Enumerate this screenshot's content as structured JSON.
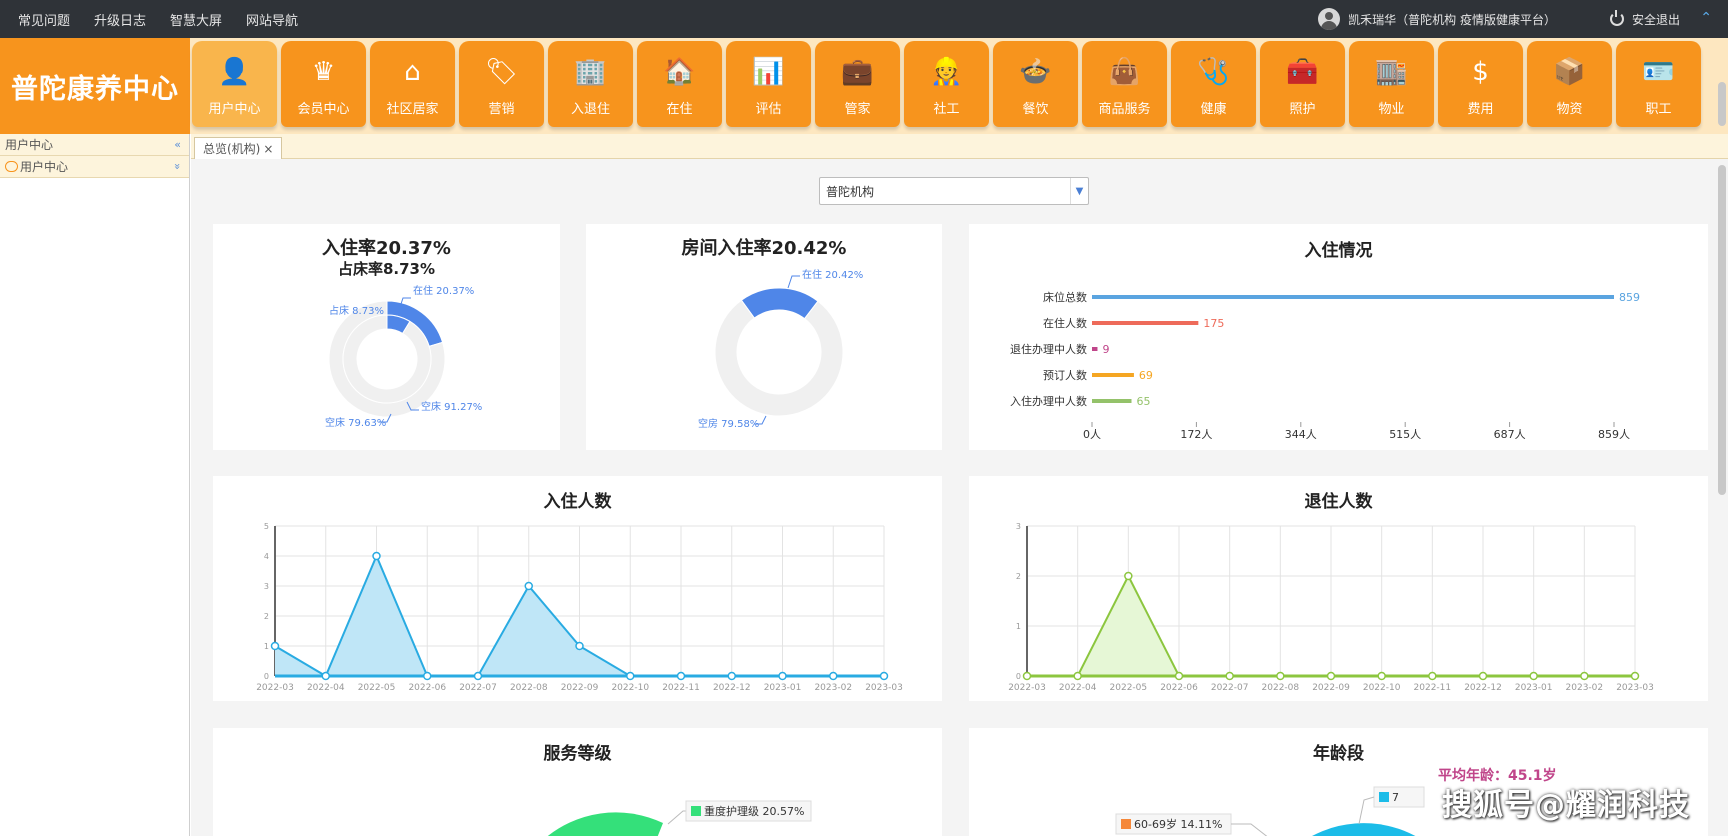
{
  "topbar": {
    "links": [
      "常见问题",
      "升级日志",
      "智慧大屏",
      "网站导航"
    ],
    "user": "凯禾瑞华（普陀机构 疫情版健康平台）",
    "logout": "安全退出",
    "collapse_glyph": "⌃"
  },
  "brand": "普陀康养中心",
  "nav": [
    {
      "label": "用户中心",
      "icon": "user-icon",
      "glyph": "👤",
      "active": true
    },
    {
      "label": "会员中心",
      "icon": "crown-icon",
      "glyph": "♛"
    },
    {
      "label": "社区居家",
      "icon": "home-icon",
      "glyph": "⌂"
    },
    {
      "label": "营销",
      "icon": "tag-icon",
      "glyph": "🏷"
    },
    {
      "label": "入退住",
      "icon": "building-icon",
      "glyph": "🏢"
    },
    {
      "label": "在住",
      "icon": "hand-house-icon",
      "glyph": "🏠"
    },
    {
      "label": "评估",
      "icon": "bar-chart-icon",
      "glyph": "📊"
    },
    {
      "label": "管家",
      "icon": "briefcase-icon",
      "glyph": "💼"
    },
    {
      "label": "社工",
      "icon": "worker-icon",
      "glyph": "👷"
    },
    {
      "label": "餐饮",
      "icon": "food-icon",
      "glyph": "🍲"
    },
    {
      "label": "商品服务",
      "icon": "shopping-bag-icon",
      "glyph": "👜"
    },
    {
      "label": "健康",
      "icon": "stethoscope-icon",
      "glyph": "🩺"
    },
    {
      "label": "照护",
      "icon": "first-aid-icon",
      "glyph": "🧰"
    },
    {
      "label": "物业",
      "icon": "property-icon",
      "glyph": "🏬"
    },
    {
      "label": "费用",
      "icon": "dollar-icon",
      "glyph": "$"
    },
    {
      "label": "物资",
      "icon": "box-icon",
      "glyph": "📦"
    },
    {
      "label": "职工",
      "icon": "id-card-icon",
      "glyph": "🪪"
    }
  ],
  "sidebar": {
    "header": "用户中心",
    "header_toggle": "«",
    "item": "用户中心",
    "item_toggle": "»"
  },
  "tab": {
    "label": "总览(机构)",
    "close": "×"
  },
  "org_select": {
    "value": "普陀机构",
    "arrow": "▼"
  },
  "cards": {
    "occupancy": {
      "title": "入住率20.37%",
      "subtitle": "占床率8.73%",
      "labels": {
        "in": "在住 20.37%",
        "bed": "占床 8.73%",
        "empty_in": "空床 91.27%",
        "empty_bed": "空床 79.63%"
      }
    },
    "room": {
      "title": "房间入住率20.42%",
      "labels": {
        "in": "在住 20.42%",
        "empty": "空房 79.58%"
      }
    },
    "status": {
      "title": "入住情况"
    },
    "checkin": {
      "title": "入住人数"
    },
    "checkout": {
      "title": "退住人数"
    },
    "service": {
      "title": "服务等级",
      "legend": "重度护理级 20.57%"
    },
    "age": {
      "title": "年龄段",
      "avg": "平均年龄：45.1岁",
      "legend": "60-69岁 14.11%",
      "legend2": "7"
    }
  },
  "chart_data": [
    {
      "type": "pie",
      "title": "入住率20.37%",
      "subtitle": "占床率8.73%",
      "rings": [
        {
          "slices": [
            {
              "name": "在住",
              "value": 20.37
            },
            {
              "name": "空床",
              "value": 79.63
            }
          ]
        },
        {
          "slices": [
            {
              "name": "占床",
              "value": 8.73
            },
            {
              "name": "空床",
              "value": 91.27
            }
          ]
        }
      ],
      "colors": {
        "filled": "#4f86e8",
        "empty": "#f0f0f0"
      }
    },
    {
      "type": "pie",
      "title": "房间入住率20.42%",
      "slices": [
        {
          "name": "在住",
          "value": 20.42
        },
        {
          "name": "空房",
          "value": 79.58
        }
      ],
      "colors": {
        "filled": "#4f86e8",
        "empty": "#f0f0f0"
      }
    },
    {
      "type": "bar",
      "title": "入住情况",
      "orientation": "horizontal",
      "categories": [
        "床位总数",
        "在住人数",
        "退住办理中人数",
        "预订人数",
        "入住办理中人数"
      ],
      "values": [
        859,
        175,
        9,
        69,
        65
      ],
      "colors": [
        "#5aa4e0",
        "#ee6b5a",
        "#c0458a",
        "#f5a623",
        "#94c26a"
      ],
      "xticks": [
        "0人",
        "172人",
        "344人",
        "515人",
        "687人",
        "859人"
      ],
      "xlim": [
        0,
        859
      ]
    },
    {
      "type": "area",
      "title": "入住人数",
      "x": [
        "2022-03",
        "2022-04",
        "2022-05",
        "2022-06",
        "2022-07",
        "2022-08",
        "2022-09",
        "2022-10",
        "2022-11",
        "2022-12",
        "2023-01",
        "2023-02",
        "2023-03"
      ],
      "values": [
        1,
        0,
        4,
        0,
        0,
        3,
        1,
        0,
        0,
        0,
        0,
        0,
        0
      ],
      "ylim": [
        0,
        5
      ],
      "yticks": [
        0,
        1,
        2,
        3,
        4,
        5
      ],
      "color": "#29abe2",
      "fill": "#bfe6f7"
    },
    {
      "type": "area",
      "title": "退住人数",
      "x": [
        "2022-03",
        "2022-04",
        "2022-05",
        "2022-06",
        "2022-07",
        "2022-08",
        "2022-09",
        "2022-10",
        "2022-11",
        "2022-12",
        "2023-01",
        "2023-02",
        "2023-03"
      ],
      "values": [
        0,
        0,
        2,
        0,
        0,
        0,
        0,
        0,
        0,
        0,
        0,
        0,
        0
      ],
      "ylim": [
        0,
        3
      ],
      "yticks": [
        0,
        1,
        2,
        3
      ],
      "color": "#8cc63f",
      "fill": "#e6f7d6"
    }
  ],
  "watermark": "搜狐号@耀润科技"
}
